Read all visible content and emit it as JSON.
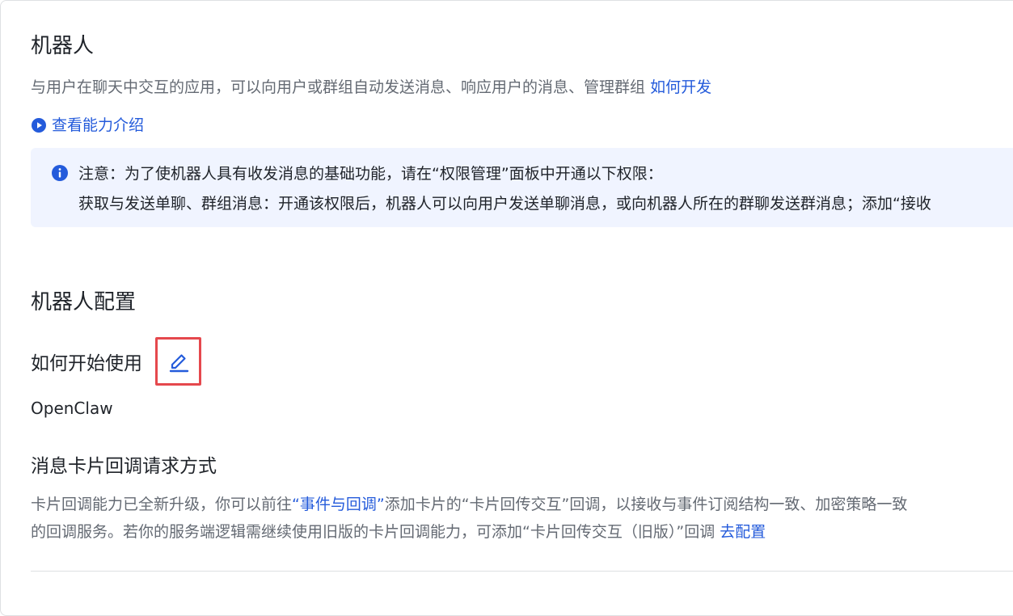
{
  "header": {
    "title": "机器人",
    "description": "与用户在聊天中交互的应用，可以向用户或群组自动发送消息、响应用户的消息、管理群组",
    "how_to_develop_link": "如何开发",
    "capability_link": "查看能力介绍"
  },
  "notice": {
    "line1": "注意：为了使机器人具有收发消息的基础功能，请在“权限管理”面板中开通以下权限：",
    "line2": "获取与发送单聊、群组消息：开通该权限后，机器人可以向用户发送单聊消息，或向机器人所在的群聊发送群消息；添加“接收"
  },
  "config": {
    "section_title": "机器人配置",
    "how_to_start_label": "如何开始使用",
    "how_to_start_value": "OpenClaw",
    "card_callback_title": "消息卡片回调请求方式",
    "card_callback_text_1": "卡片回调能力已全新升级，你可以前往",
    "card_callback_link_events": "“事件与回调”",
    "card_callback_text_2": "添加卡片的“卡片回传交互”回调，以接收与事件订阅结构一致、加密策略一致",
    "card_callback_text_3": "的回调服务。若你的服务端逻辑需继续使用旧版的卡片回调能力，可添加“卡片回传交互（旧版）”回调 ",
    "card_callback_link_configure": "去配置"
  },
  "colors": {
    "link": "#245bdb",
    "notice_bg": "#f0f4ff",
    "highlight_border": "#e5484d"
  },
  "icons": {
    "capability": "play-circle-icon",
    "notice": "info-circle-icon",
    "edit": "edit-pencil-icon"
  }
}
